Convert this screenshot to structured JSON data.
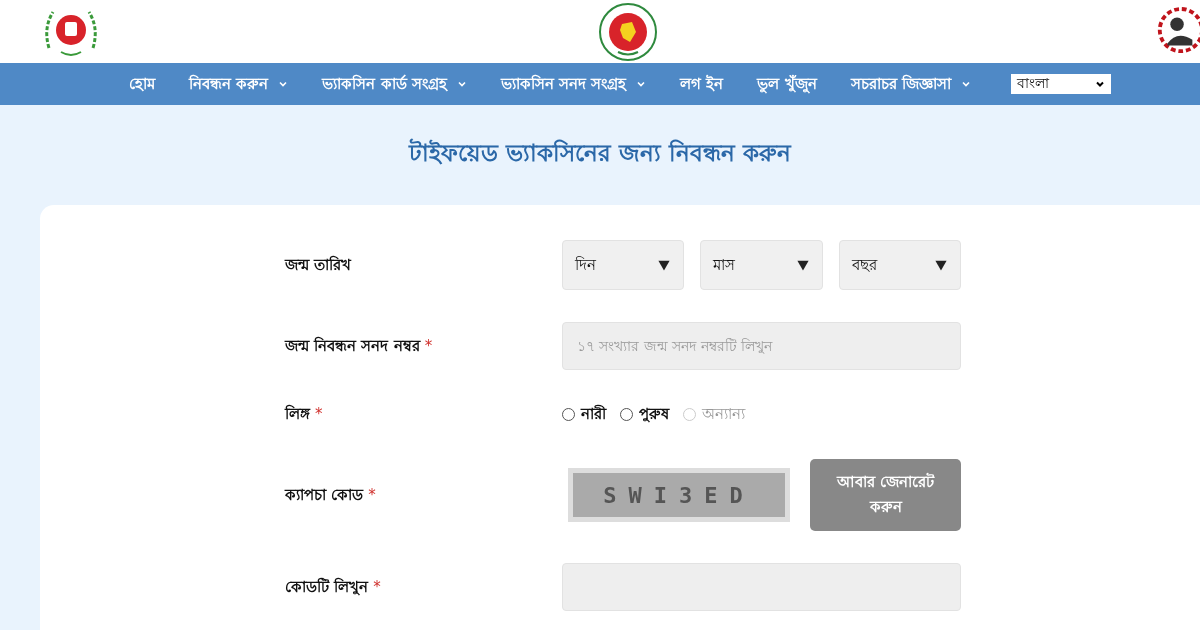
{
  "nav": {
    "items": [
      {
        "label": "হোম",
        "dropdown": false
      },
      {
        "label": "নিবন্ধন করুন",
        "dropdown": true
      },
      {
        "label": "ভ্যাকসিন কার্ড সংগ্রহ",
        "dropdown": true
      },
      {
        "label": "ভ্যাকসিন সনদ সংগ্রহ",
        "dropdown": true
      },
      {
        "label": "লগ ইন",
        "dropdown": false
      },
      {
        "label": "ভুল খুঁজুন",
        "dropdown": false
      },
      {
        "label": "সচরাচর জিজ্ঞাসা",
        "dropdown": true
      }
    ],
    "language": {
      "value": "বাংলা"
    }
  },
  "page_title": "টাইফয়েড ভ্যাকসিনের জন্য নিবন্ধন করুন",
  "form": {
    "fields": [
      {
        "kind": "date",
        "label": "জন্ম তারিখ",
        "selects": [
          "দিন",
          "মাস",
          "বছর"
        ]
      },
      {
        "kind": "text",
        "label": "জন্ম নিবন্ধন সনদ নম্বর",
        "mark": "*",
        "placeholder": "১৭ সংখ্যার জন্ম সনদ নম্বরটি লিখুন"
      },
      {
        "kind": "radio",
        "label": "লিঙ্গ",
        "mark": "*",
        "options": [
          {
            "label": "নারী",
            "selected": false,
            "disabled": false
          },
          {
            "label": "পুরুষ",
            "selected": false,
            "disabled": false
          },
          {
            "label": "অন্যান্য",
            "selected": false,
            "disabled": true
          }
        ]
      },
      {
        "kind": "captcha",
        "label": "ক্যাপচা কোড",
        "mark": "*",
        "code": "SWI3ED",
        "button": "আবার জেনারেট করুন"
      },
      {
        "kind": "text",
        "label": "কোডটি লিখুন",
        "mark": "*"
      }
    ]
  }
}
